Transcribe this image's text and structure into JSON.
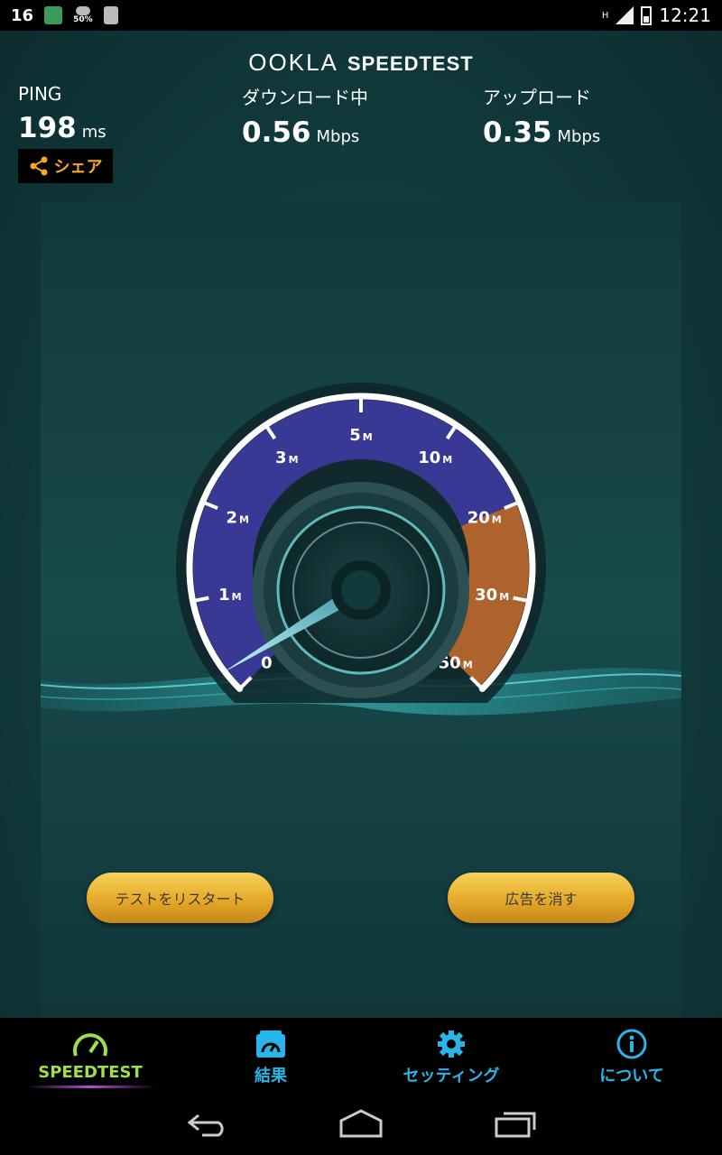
{
  "status_bar": {
    "notification_count": "16",
    "battery_label": "50%",
    "time": "12:21",
    "network_type": "H"
  },
  "header": {
    "brand_ookla": "OOKLA",
    "brand_speedtest": "SPEEDTEST"
  },
  "ping": {
    "label": "PING",
    "value": "198",
    "unit": "ms"
  },
  "share": {
    "label": "シェア"
  },
  "download": {
    "label": "ダウンロード中",
    "value": "0.56",
    "unit": "Mbps"
  },
  "upload": {
    "label": "アップロード",
    "value": "0.35",
    "unit": "Mbps"
  },
  "gauge": {
    "ticks": [
      {
        "text": "0",
        "sub": ""
      },
      {
        "text": "1",
        "sub": "M"
      },
      {
        "text": "2",
        "sub": "M"
      },
      {
        "text": "3",
        "sub": "M"
      },
      {
        "text": "5",
        "sub": "M"
      },
      {
        "text": "10",
        "sub": "M"
      },
      {
        "text": "20",
        "sub": "M"
      },
      {
        "text": "30",
        "sub": "M"
      },
      {
        "text": "50",
        "sub": "M"
      }
    ],
    "current_value_mbps": 0.56,
    "colors": {
      "ring": "#ffffff",
      "low_fill": "#3b3a9a",
      "high_fill": "#c0692c"
    }
  },
  "buttons": {
    "restart": "テストをリスタート",
    "remove_ads": "広告を消す"
  },
  "nav": {
    "items": [
      {
        "label": "SPEEDTEST",
        "icon": "speedometer-icon",
        "active": true
      },
      {
        "label": "結果",
        "icon": "results-icon",
        "active": false
      },
      {
        "label": "セッティング",
        "icon": "gear-icon",
        "active": false
      },
      {
        "label": "について",
        "icon": "info-icon",
        "active": false
      }
    ]
  },
  "accent_colors": {
    "orange": "#f7a81e",
    "green": "#9ee04a",
    "blue": "#27b5ea"
  }
}
